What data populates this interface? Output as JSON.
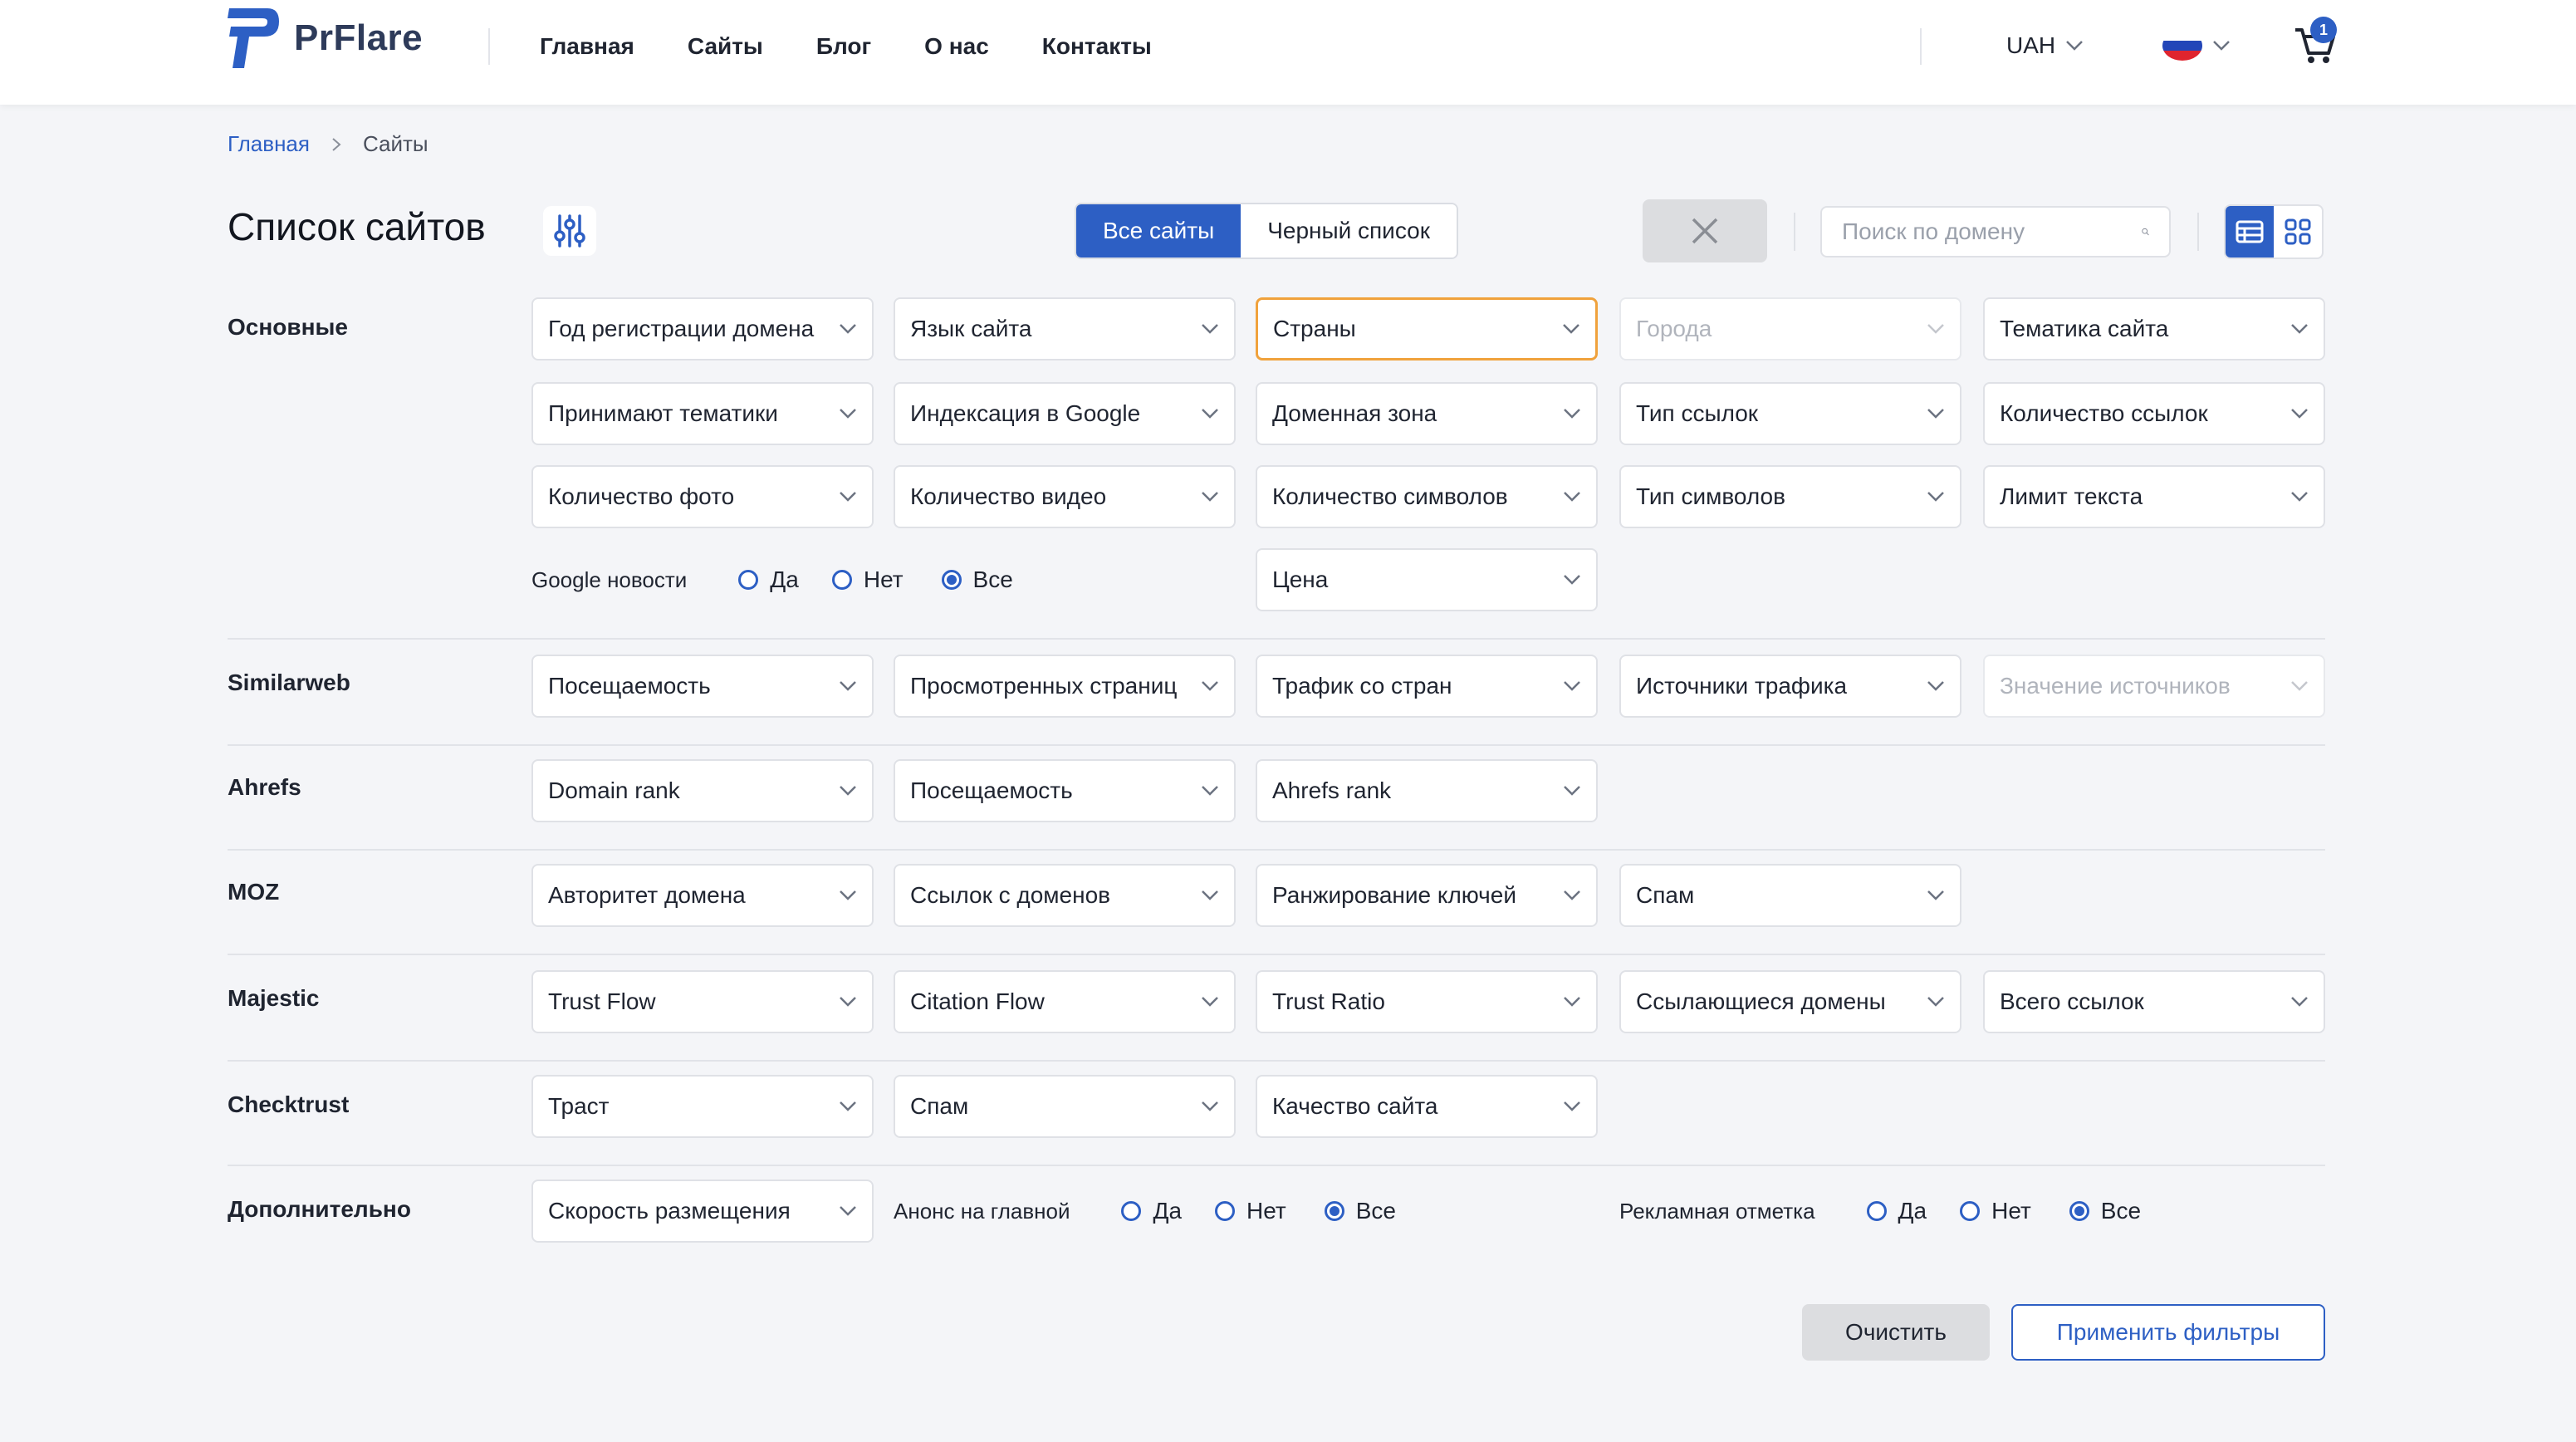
{
  "brand": {
    "name": "PrFlare",
    "color": "#2d5fc4"
  },
  "nav": [
    "Главная",
    "Сайты",
    "Блог",
    "О нас",
    "Контакты"
  ],
  "currency": "UAH",
  "cart": {
    "count": "1"
  },
  "breadcrumb": {
    "home": "Главная",
    "current": "Сайты"
  },
  "page": {
    "title": "Список сайтов"
  },
  "tabs": {
    "all": "Все сайты",
    "blacklist": "Черный список"
  },
  "search": {
    "placeholder": "Поиск по домену"
  },
  "sections": {
    "basic": "Основные",
    "similarweb": "Similarweb",
    "ahrefs": "Ahrefs",
    "moz": "MOZ",
    "majestic": "Majestic",
    "checktrust": "Checktrust",
    "extra": "Дополнительно"
  },
  "filters": {
    "basic_row1": [
      "Год регистрации домена",
      "Язык сайта",
      "Страны",
      "Города",
      "Тематика сайта"
    ],
    "basic_row2": [
      "Принимают тематики",
      "Индексация в Google",
      "Доменная зона",
      "Тип ссылок",
      "Количество ссылок"
    ],
    "basic_row3": [
      "Количество фото",
      "Количество видео",
      "Количество символов",
      "Тип символов",
      "Лимит текста"
    ],
    "price": "Цена",
    "similarweb": [
      "Посещаемость",
      "Просмотренных страниц",
      "Трафик со стран",
      "Источники трафика",
      "Значение источников"
    ],
    "ahrefs": [
      "Domain rank",
      "Посещаемость",
      "Ahrefs rank"
    ],
    "moz": [
      "Авторитет домена",
      "Ссылок с доменов",
      "Ранжирование ключей",
      "Спам"
    ],
    "majestic": [
      "Trust Flow",
      "Citation Flow",
      "Trust Ratio",
      "Ссылающиеся домены",
      "Всего ссылок"
    ],
    "checktrust": [
      "Траст",
      "Спам",
      "Качество сайта"
    ],
    "extra_speed": "Скорость размещения"
  },
  "radios": {
    "google_news": {
      "label": "Google новости",
      "options": [
        "Да",
        "Нет",
        "Все"
      ],
      "selected": "Все"
    },
    "homepage_announce": {
      "label": "Анонс на главной",
      "options": [
        "Да",
        "Нет",
        "Все"
      ],
      "selected": "Все"
    },
    "ad_mark": {
      "label": "Рекламная отметка",
      "options": [
        "Да",
        "Нет",
        "Все"
      ],
      "selected": "Все"
    }
  },
  "buttons": {
    "clear": "Очистить",
    "apply": "Применить фильтры"
  }
}
